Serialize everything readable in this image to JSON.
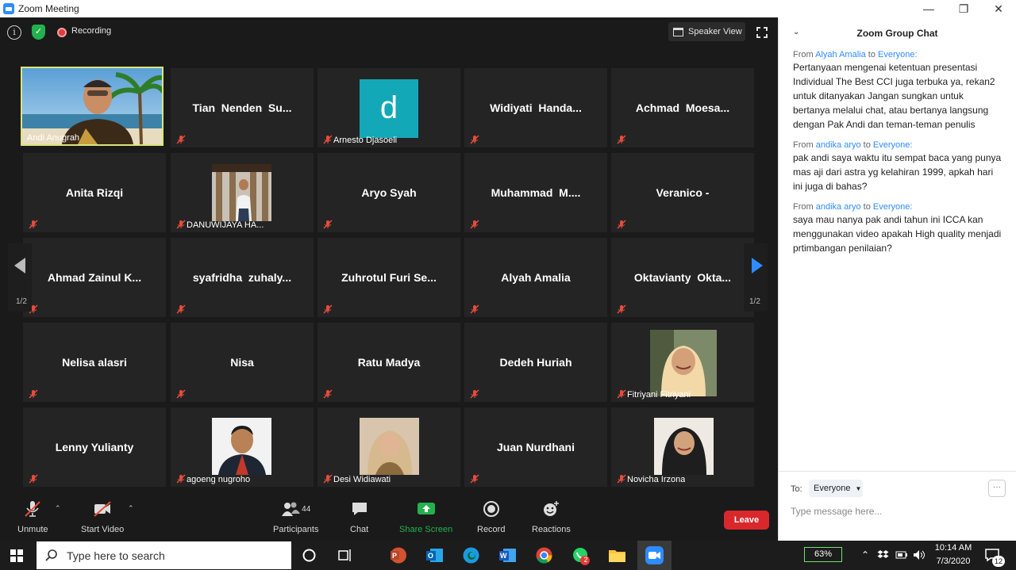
{
  "window": {
    "title": "Zoom Meeting"
  },
  "meeting": {
    "recording_label": "Recording",
    "speaker_view_label": "Speaker View",
    "page_indicator_left": "1/2",
    "page_indicator_right": "1/2"
  },
  "participants": [
    {
      "name": "Andi Anugrah",
      "type": "video",
      "active": true
    },
    {
      "name": "Tian  Nenden  Su...",
      "type": "name"
    },
    {
      "name": "Arnesto Djasoeli",
      "type": "avatar",
      "letter": "d"
    },
    {
      "name": "Widiyati  Handa...",
      "type": "name"
    },
    {
      "name": "Achmad  Moesa...",
      "type": "name"
    },
    {
      "name": "Anita Rizqi",
      "type": "name"
    },
    {
      "name": "DANUWIJAYA HA...",
      "type": "photo"
    },
    {
      "name": "Aryo Syah",
      "type": "name"
    },
    {
      "name": "Muhammad  M....",
      "type": "name"
    },
    {
      "name": "Veranico -",
      "type": "name"
    },
    {
      "name": "Ahmad Zainul K...",
      "type": "name"
    },
    {
      "name": "syafridha  zuhaly...",
      "type": "name"
    },
    {
      "name": "Zuhrotul Furi Se...",
      "type": "name"
    },
    {
      "name": "Alyah Amalia",
      "type": "name"
    },
    {
      "name": "Oktavianty  Okta...",
      "type": "name"
    },
    {
      "name": "Nelisa alasri",
      "type": "name"
    },
    {
      "name": "Nisa",
      "type": "name"
    },
    {
      "name": "Ratu Madya",
      "type": "name"
    },
    {
      "name": "Dedeh Huriah",
      "type": "name"
    },
    {
      "name": "Fitriyani Fitriyani",
      "type": "photo"
    },
    {
      "name": "Lenny Yulianty",
      "type": "name"
    },
    {
      "name": "agoeng nugroho",
      "type": "photo"
    },
    {
      "name": "Desi Widiawati",
      "type": "photo"
    },
    {
      "name": "Juan Nurdhani",
      "type": "name"
    },
    {
      "name": "Novicha Irzona",
      "type": "photo"
    }
  ],
  "toolbar": {
    "unmute": "Unmute",
    "start_video": "Start Video",
    "participants": "Participants",
    "participants_count": "44",
    "chat": "Chat",
    "share_screen": "Share Screen",
    "record": "Record",
    "reactions": "Reactions",
    "leave": "Leave"
  },
  "chat": {
    "title": "Zoom Group Chat",
    "messages": [
      {
        "from_prefix": "From",
        "sender": "Alyah Amalia",
        "to_word": "to",
        "recipient": "Everyone:",
        "text": "Pertanyaan mengenai ketentuan presentasi Individual The Best CCI juga terbuka ya, rekan2 untuk ditanyakan Jangan sungkan untuk bertanya melalui chat, atau bertanya langsung dengan Pak Andi dan teman-teman penulis"
      },
      {
        "from_prefix": "From",
        "sender": "andika aryo",
        "to_word": "to",
        "recipient": "Everyone:",
        "text": "pak andi saya waktu itu sempat baca yang punya mas aji dari astra yg kelahiran 1999, apkah hari ini juga di bahas?"
      },
      {
        "from_prefix": "From",
        "sender": "andika aryo",
        "to_word": "to",
        "recipient": "Everyone:",
        "text": "saya mau nanya pak andi tahun ini ICCA kan menggunakan video apakah High quality menjadi prtimbangan penilaian?"
      }
    ],
    "to_label": "To:",
    "to_value": "Everyone",
    "input_placeholder": "Type message here...",
    "more_label": "···"
  },
  "taskbar": {
    "search_placeholder": "Type here to search",
    "battery": "63%",
    "time": "10:14 AM",
    "date": "7/3/2020",
    "whatsapp_badge": "2",
    "notification_count": "12"
  },
  "colors": {
    "accent": "#2d8cff",
    "leave": "#d8282c",
    "share": "#23b14d",
    "active_border": "#d9e57a"
  }
}
